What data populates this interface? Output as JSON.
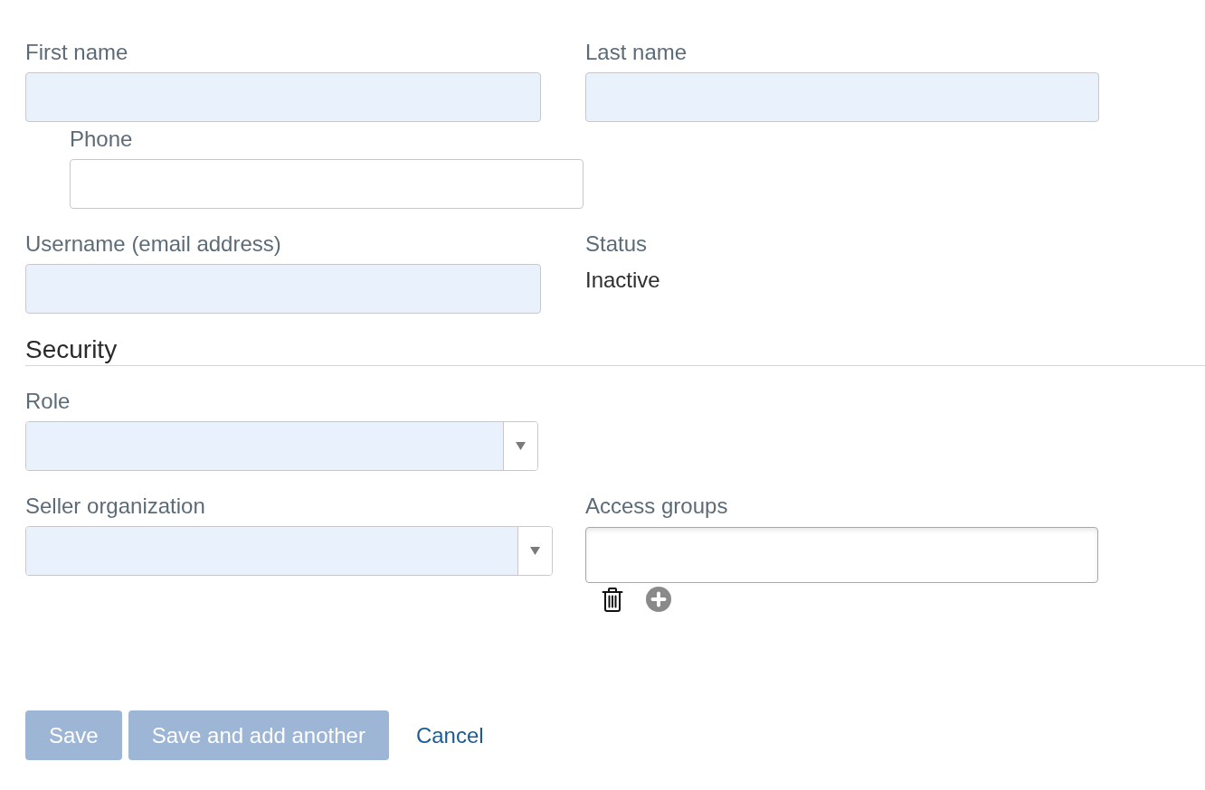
{
  "first_name": {
    "label": "First name",
    "highlighted": true
  },
  "last_name": {
    "label": "Last name",
    "highlighted": true
  },
  "phone": {
    "label": "Phone",
    "highlighted": false
  },
  "username": {
    "label": "Username (email address)",
    "highlighted": true
  },
  "status": {
    "label": "Status",
    "value": "Inactive"
  },
  "security": {
    "heading": "Security",
    "role": {
      "label": "Role",
      "highlighted": true
    },
    "seller_organization": {
      "label": "Seller organization",
      "highlighted": true
    },
    "access_groups": {
      "label": "Access groups"
    }
  },
  "buttons": [
    {
      "label": "Save",
      "kind": "primary",
      "disabled": true
    },
    {
      "label": "Save and add another",
      "kind": "primary",
      "disabled": true
    },
    {
      "label": "Cancel",
      "kind": "link"
    }
  ]
}
